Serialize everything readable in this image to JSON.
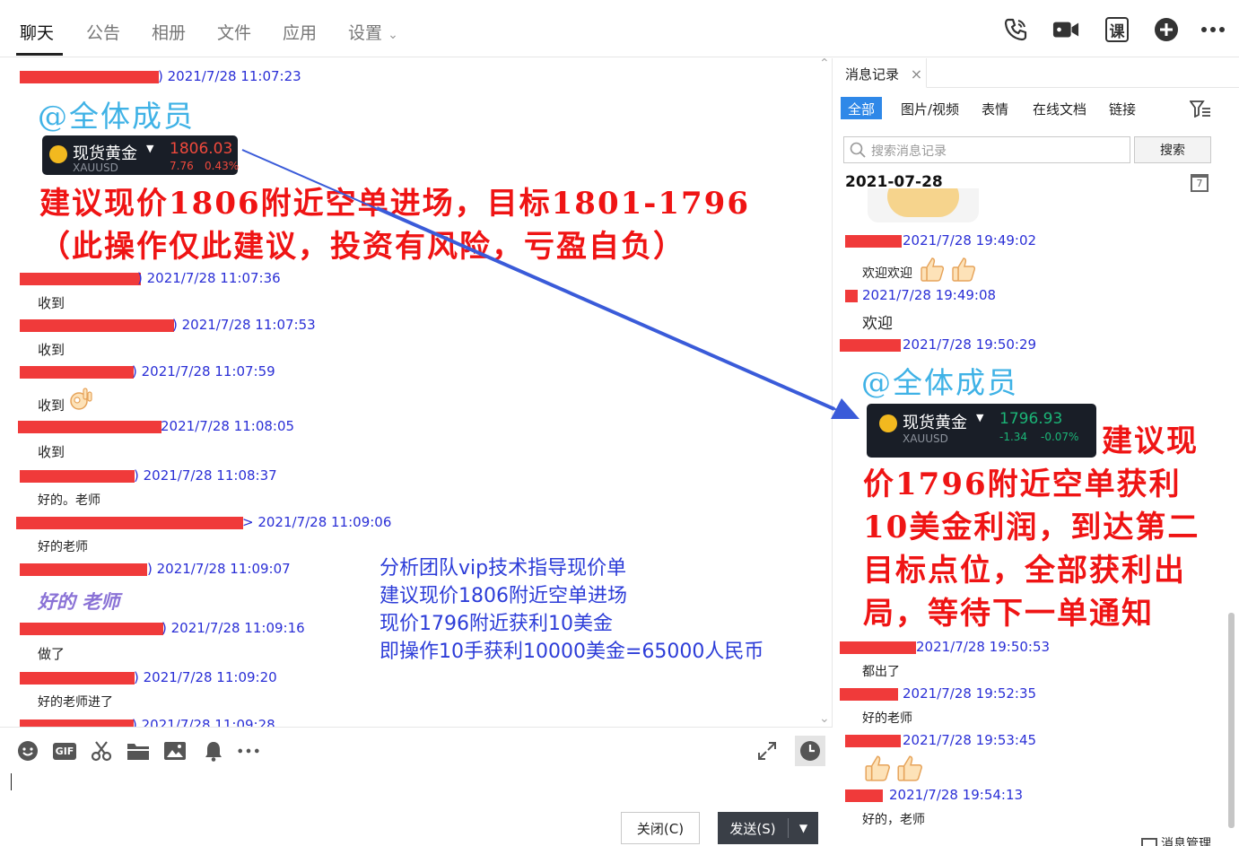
{
  "tabs": [
    "聊天",
    "公告",
    "相册",
    "文件",
    "应用",
    "设置"
  ],
  "tab_chevron": "⌄",
  "top_icons": [
    "phone-icon",
    "video-icon",
    "course-icon",
    "add-circle-icon",
    "more-icon"
  ],
  "course_label": "课",
  "chat": {
    "messages": [
      {
        "time": ") 2021/7/28 11:07:23"
      },
      {
        "time": ") 2021/7/28 11:07:36",
        "text": "收到"
      },
      {
        "time": ") 2021/7/28 11:07:53",
        "text": "收到"
      },
      {
        "time": ") 2021/7/28 11:07:59",
        "text": "收到"
      },
      {
        "time": "2021/7/28 11:08:05",
        "text": "收到"
      },
      {
        "time": ") 2021/7/28 11:08:37",
        "text": "好的。老师"
      },
      {
        "time": "> 2021/7/28 11:09:06",
        "text": "好的老师"
      },
      {
        "time": ") 2021/7/28 11:09:07",
        "text": "好的 老师"
      },
      {
        "time": ") 2021/7/28 11:09:16",
        "text": "做了"
      },
      {
        "time": ") 2021/7/28 11:09:20",
        "text": "好的老师进了"
      },
      {
        "time": ") 2021/7/28 11:09:28"
      }
    ],
    "at_all": "@全体成员",
    "gold_card": {
      "name": "现货黄金",
      "symbol": "XAUUSD",
      "price": "1806.03",
      "change": "7.76",
      "change_pct": "0.43%"
    },
    "red_note": "建议现价1806附近空单进场，目标1801-1796（此操作仅此建议，投资有风险，亏盈自负）",
    "blue_note": [
      "分析团队vip技术指导现价单",
      "建议现价1806附近空单进场",
      "现价1796附近获利10美金",
      "即操作10手获利10000美金=65000人民币"
    ]
  },
  "composer": {
    "close_label": "关闭(C)",
    "send_label": "发送(S)",
    "tools": [
      "emoji-icon",
      "gif-icon",
      "scissors-icon",
      "folder-icon",
      "image-icon",
      "bell-icon",
      "more-icon"
    ],
    "gif_label": "GIF"
  },
  "history": {
    "tab_label": "消息记录",
    "close_glyph": "×",
    "filters": [
      "全部",
      "图片/视频",
      "表情",
      "在线文档",
      "链接"
    ],
    "search_placeholder": "搜索消息记录",
    "search_button": "搜索",
    "date": "2021-07-28",
    "calendar_label": "7",
    "messages": [
      {
        "time": "2021/7/28 19:49:02",
        "text": "欢迎欢迎"
      },
      {
        "time": "2021/7/28 19:49:08",
        "text": "欢迎"
      },
      {
        "time": "2021/7/28 19:50:29"
      },
      {
        "time": "2021/7/28 19:50:53",
        "text": "都出了"
      },
      {
        "time": "2021/7/28 19:52:35",
        "text": "好的老师"
      },
      {
        "time": "2021/7/28 19:53:45"
      },
      {
        "time": "2021/7/28 19:54:13",
        "text": "好的，老师"
      }
    ],
    "at_all": "@全体成员",
    "gold_card": {
      "name": "现货黄金",
      "symbol": "XAUUSD",
      "price": "1796.93",
      "change": "-1.34",
      "change_pct": "-0.07%"
    },
    "red_note": "建议现价1796附近空单获利10美金利润，到达第二目标点位，全部获利出局，等待下一单通知",
    "footer_fragment": "消息管理"
  },
  "colors": {
    "redaction": "#f03a3a",
    "timestamp": "#2a2fd6",
    "annotation_red": "#ef1414",
    "annotation_blue": "#2d3dd8",
    "arrow": "#3a5bd9",
    "accent": "#2f88e8"
  }
}
